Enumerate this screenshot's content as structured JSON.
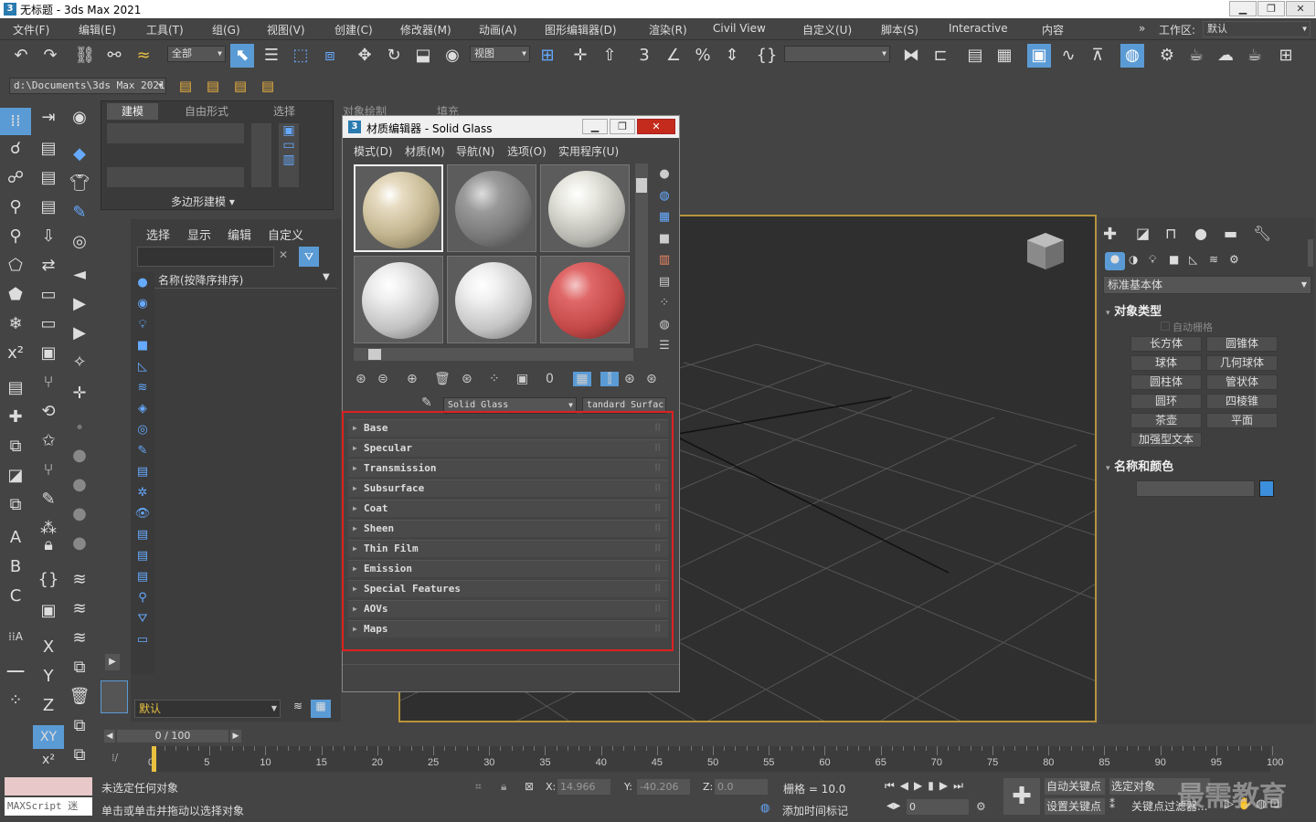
{
  "window": {
    "title": "无标题 - 3ds Max 2021",
    "icon_text": "3"
  },
  "menu": [
    "文件(F)",
    "编辑(E)",
    "工具(T)",
    "组(G)",
    "视图(V)",
    "创建(C)",
    "修改器(M)",
    "动画(A)",
    "图形编辑器(D)",
    "渲染(R)",
    "Civil View",
    "自定义(U)",
    "脚本(S)",
    "Interactive",
    "内容"
  ],
  "workspace": {
    "label": "工作区:",
    "value": "默认"
  },
  "toolbar": {
    "selection_filter": "全部",
    "ref_coord": "视图",
    "named_sel": ""
  },
  "project_path": "d:\\Documents\\3ds Max 2021",
  "ribbon": {
    "tabs": [
      "建模",
      "自由形式",
      "选择",
      "对象绘制",
      "填充"
    ],
    "panel_label": "多边形建模"
  },
  "scene_explorer": {
    "menu": [
      "选择",
      "显示",
      "编辑",
      "自定义"
    ],
    "sort_label": "名称(按降序排序)",
    "layer": "默认"
  },
  "material_editor": {
    "title": "材质编辑器 - Solid Glass",
    "icon_text": "3",
    "menu": [
      "模式(D)",
      "材质(M)",
      "导航(N)",
      "选项(O)",
      "实用程序(U)"
    ],
    "material_name": "Solid Glass",
    "material_type": "tandard Surfac",
    "rollouts": [
      "Base",
      "Specular",
      "Transmission",
      "Subsurface",
      "Coat",
      "Sheen",
      "Thin Film",
      "Emission",
      "Special Features",
      "AOVs",
      "Maps"
    ],
    "colors": {
      "highlight": "#e02020"
    }
  },
  "command_panel": {
    "category": "标准基本体",
    "object_type_header": "对象类型",
    "autogrid": "自动栅格",
    "buttons": [
      [
        "长方体",
        "圆锥体"
      ],
      [
        "球体",
        "几何球体"
      ],
      [
        "圆柱体",
        "管状体"
      ],
      [
        "圆环",
        "四棱锥"
      ],
      [
        "茶壶",
        "平面"
      ],
      [
        "加强型文本"
      ]
    ],
    "name_color_header": "名称和颜色",
    "colors": {
      "object_color": "#3c8fdc"
    }
  },
  "timeline": {
    "frame": "0 / 100",
    "ticks": [
      "0",
      "5",
      "10",
      "15",
      "20",
      "25",
      "30",
      "35",
      "40",
      "45",
      "50",
      "55",
      "60",
      "65",
      "70",
      "75",
      "80",
      "85",
      "90",
      "95",
      "100"
    ]
  },
  "status": {
    "selected": "未选定任何对象",
    "hint": "单击或单击并拖动以选择对象",
    "maxscript": "MAXScript 迷",
    "x_label": "X:",
    "x": "14.966",
    "y_label": "Y:",
    "y": "-40.206",
    "z_label": "Z:",
    "z": "0.0",
    "grid": "栅格 = 10.0",
    "add_time_tag": "添加时间标记",
    "auto_key": "自动关键点",
    "selected_obj": "选定对象",
    "set_key": "设置关键点",
    "key_filter": "关键点过滤器...",
    "frame_field": "0"
  },
  "watermark": "最需教育"
}
